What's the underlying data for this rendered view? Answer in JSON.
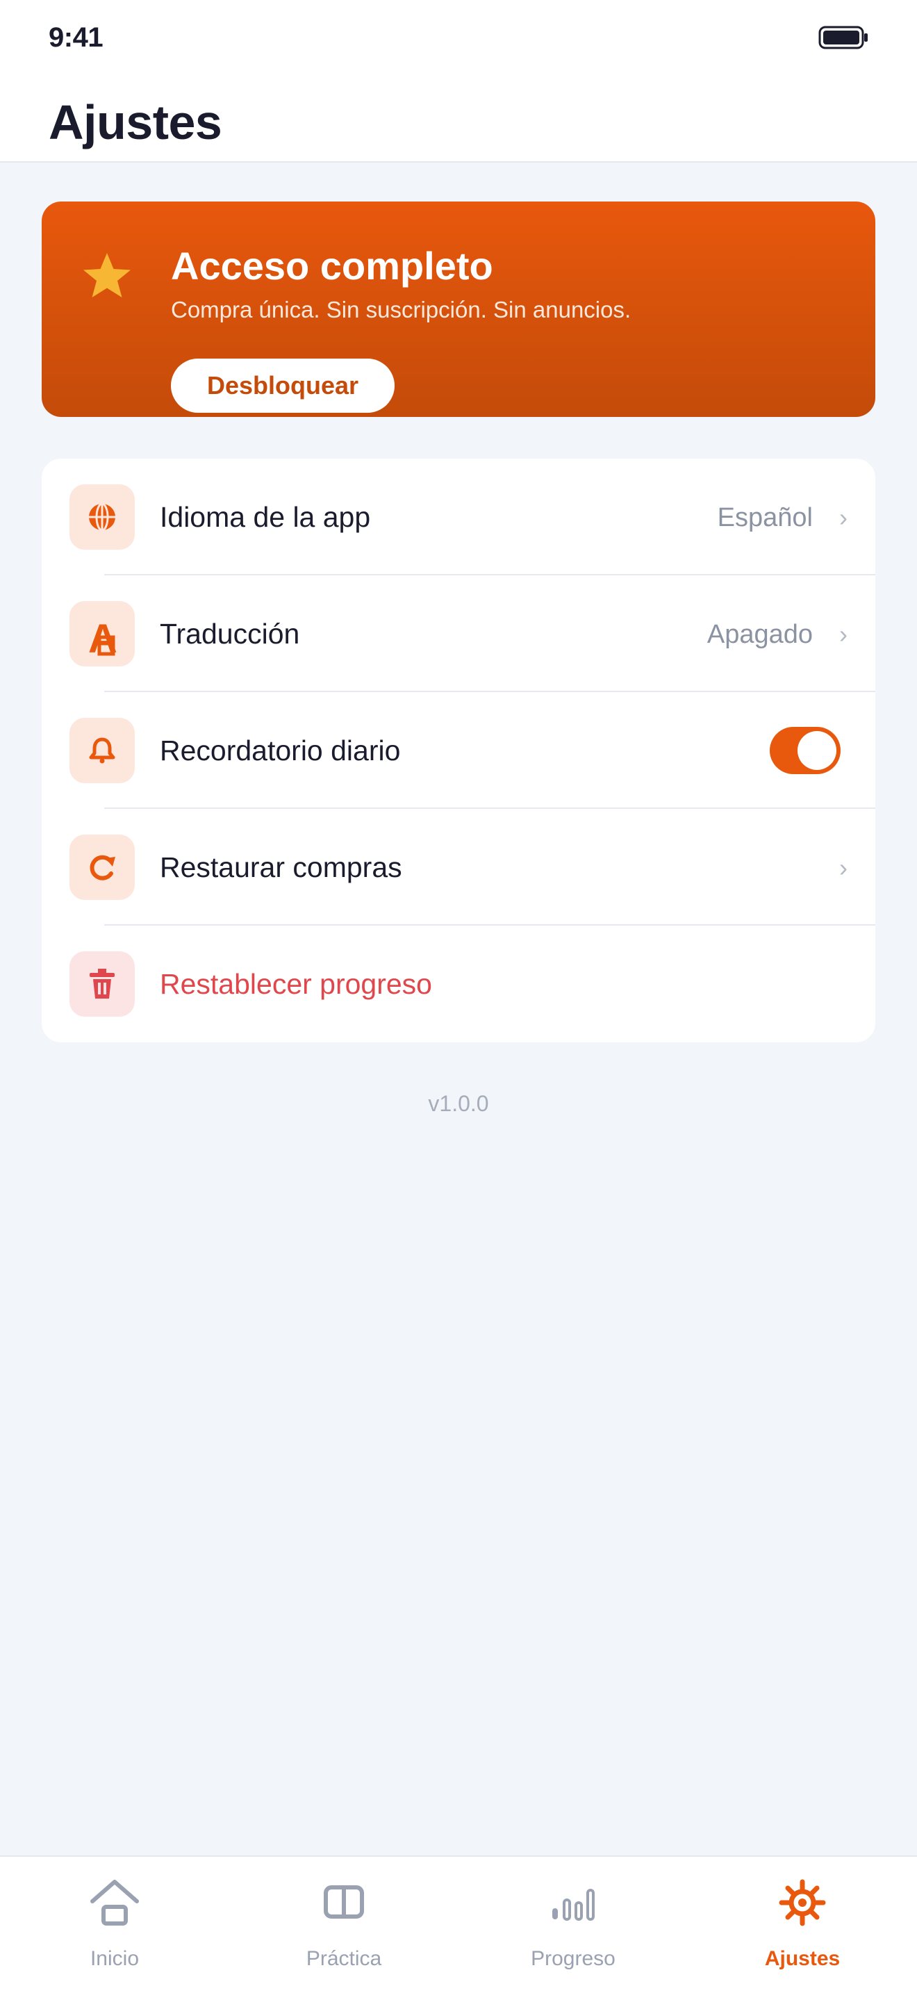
{
  "status_bar": {
    "time": "9:41"
  },
  "header": {
    "title": "Ajustes"
  },
  "promo": {
    "title": "Acceso completo",
    "subtitle": "Compra única. Sin suscripción. Sin anuncios.",
    "button_label": "Desbloquear"
  },
  "settings": {
    "items": [
      {
        "label": "Idioma de la app",
        "value": "Español",
        "icon": "globe-icon",
        "control": "chevron"
      },
      {
        "label": "Traducción",
        "value": "Apagado",
        "icon": "translate-icon",
        "control": "chevron"
      },
      {
        "label": "Recordatorio diario",
        "value": "",
        "icon": "bell-icon",
        "control": "toggle",
        "toggle_on": true
      },
      {
        "label": "Restaurar compras",
        "value": "",
        "icon": "restore-icon",
        "control": "chevron"
      },
      {
        "label": "Restablecer progreso",
        "value": "",
        "icon": "trash-icon",
        "control": "none"
      }
    ]
  },
  "version": "v1.0.0",
  "tabbar": {
    "tabs": [
      {
        "label": "Inicio",
        "icon": "home-icon",
        "active": false
      },
      {
        "label": "Práctica",
        "icon": "book-icon",
        "active": false
      },
      {
        "label": "Progreso",
        "icon": "bar-chart-icon",
        "active": false
      },
      {
        "label": "Ajustes",
        "icon": "gear-icon",
        "active": true
      }
    ]
  },
  "colors": {
    "accent": "#e8580d",
    "accent_dark": "#c44b09",
    "danger": "#e0474c",
    "background": "#f2f5fa",
    "text": "#1a1c2e",
    "muted": "#8b93a3"
  }
}
